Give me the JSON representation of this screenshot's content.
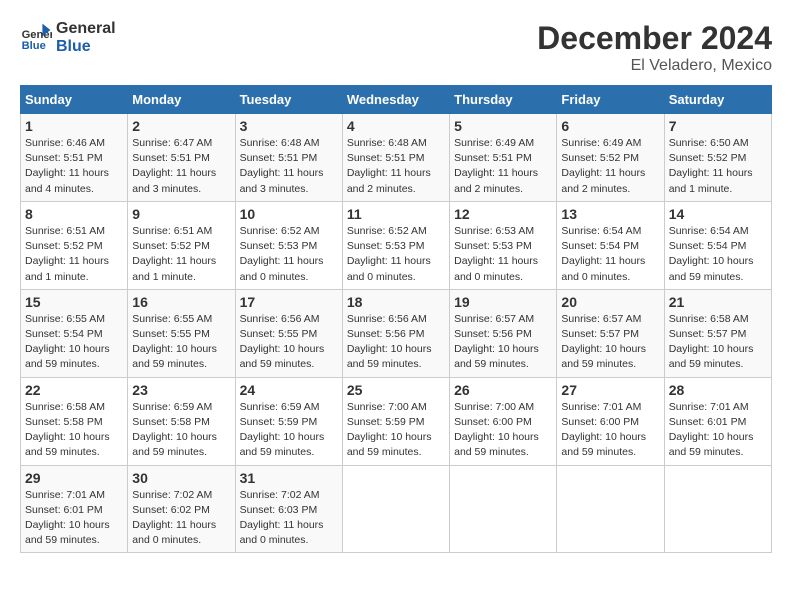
{
  "header": {
    "logo_line1": "General",
    "logo_line2": "Blue",
    "title": "December 2024",
    "subtitle": "El Veladero, Mexico"
  },
  "columns": [
    "Sunday",
    "Monday",
    "Tuesday",
    "Wednesday",
    "Thursday",
    "Friday",
    "Saturday"
  ],
  "weeks": [
    [
      {
        "day": "1",
        "info": "Sunrise: 6:46 AM\nSunset: 5:51 PM\nDaylight: 11 hours and 4 minutes."
      },
      {
        "day": "2",
        "info": "Sunrise: 6:47 AM\nSunset: 5:51 PM\nDaylight: 11 hours and 3 minutes."
      },
      {
        "day": "3",
        "info": "Sunrise: 6:48 AM\nSunset: 5:51 PM\nDaylight: 11 hours and 3 minutes."
      },
      {
        "day": "4",
        "info": "Sunrise: 6:48 AM\nSunset: 5:51 PM\nDaylight: 11 hours and 2 minutes."
      },
      {
        "day": "5",
        "info": "Sunrise: 6:49 AM\nSunset: 5:51 PM\nDaylight: 11 hours and 2 minutes."
      },
      {
        "day": "6",
        "info": "Sunrise: 6:49 AM\nSunset: 5:52 PM\nDaylight: 11 hours and 2 minutes."
      },
      {
        "day": "7",
        "info": "Sunrise: 6:50 AM\nSunset: 5:52 PM\nDaylight: 11 hours and 1 minute."
      }
    ],
    [
      {
        "day": "8",
        "info": "Sunrise: 6:51 AM\nSunset: 5:52 PM\nDaylight: 11 hours and 1 minute."
      },
      {
        "day": "9",
        "info": "Sunrise: 6:51 AM\nSunset: 5:52 PM\nDaylight: 11 hours and 1 minute."
      },
      {
        "day": "10",
        "info": "Sunrise: 6:52 AM\nSunset: 5:53 PM\nDaylight: 11 hours and 0 minutes."
      },
      {
        "day": "11",
        "info": "Sunrise: 6:52 AM\nSunset: 5:53 PM\nDaylight: 11 hours and 0 minutes."
      },
      {
        "day": "12",
        "info": "Sunrise: 6:53 AM\nSunset: 5:53 PM\nDaylight: 11 hours and 0 minutes."
      },
      {
        "day": "13",
        "info": "Sunrise: 6:54 AM\nSunset: 5:54 PM\nDaylight: 11 hours and 0 minutes."
      },
      {
        "day": "14",
        "info": "Sunrise: 6:54 AM\nSunset: 5:54 PM\nDaylight: 10 hours and 59 minutes."
      }
    ],
    [
      {
        "day": "15",
        "info": "Sunrise: 6:55 AM\nSunset: 5:54 PM\nDaylight: 10 hours and 59 minutes."
      },
      {
        "day": "16",
        "info": "Sunrise: 6:55 AM\nSunset: 5:55 PM\nDaylight: 10 hours and 59 minutes."
      },
      {
        "day": "17",
        "info": "Sunrise: 6:56 AM\nSunset: 5:55 PM\nDaylight: 10 hours and 59 minutes."
      },
      {
        "day": "18",
        "info": "Sunrise: 6:56 AM\nSunset: 5:56 PM\nDaylight: 10 hours and 59 minutes."
      },
      {
        "day": "19",
        "info": "Sunrise: 6:57 AM\nSunset: 5:56 PM\nDaylight: 10 hours and 59 minutes."
      },
      {
        "day": "20",
        "info": "Sunrise: 6:57 AM\nSunset: 5:57 PM\nDaylight: 10 hours and 59 minutes."
      },
      {
        "day": "21",
        "info": "Sunrise: 6:58 AM\nSunset: 5:57 PM\nDaylight: 10 hours and 59 minutes."
      }
    ],
    [
      {
        "day": "22",
        "info": "Sunrise: 6:58 AM\nSunset: 5:58 PM\nDaylight: 10 hours and 59 minutes."
      },
      {
        "day": "23",
        "info": "Sunrise: 6:59 AM\nSunset: 5:58 PM\nDaylight: 10 hours and 59 minutes."
      },
      {
        "day": "24",
        "info": "Sunrise: 6:59 AM\nSunset: 5:59 PM\nDaylight: 10 hours and 59 minutes."
      },
      {
        "day": "25",
        "info": "Sunrise: 7:00 AM\nSunset: 5:59 PM\nDaylight: 10 hours and 59 minutes."
      },
      {
        "day": "26",
        "info": "Sunrise: 7:00 AM\nSunset: 6:00 PM\nDaylight: 10 hours and 59 minutes."
      },
      {
        "day": "27",
        "info": "Sunrise: 7:01 AM\nSunset: 6:00 PM\nDaylight: 10 hours and 59 minutes."
      },
      {
        "day": "28",
        "info": "Sunrise: 7:01 AM\nSunset: 6:01 PM\nDaylight: 10 hours and 59 minutes."
      }
    ],
    [
      {
        "day": "29",
        "info": "Sunrise: 7:01 AM\nSunset: 6:01 PM\nDaylight: 10 hours and 59 minutes."
      },
      {
        "day": "30",
        "info": "Sunrise: 7:02 AM\nSunset: 6:02 PM\nDaylight: 11 hours and 0 minutes."
      },
      {
        "day": "31",
        "info": "Sunrise: 7:02 AM\nSunset: 6:03 PM\nDaylight: 11 hours and 0 minutes."
      },
      null,
      null,
      null,
      null
    ]
  ]
}
